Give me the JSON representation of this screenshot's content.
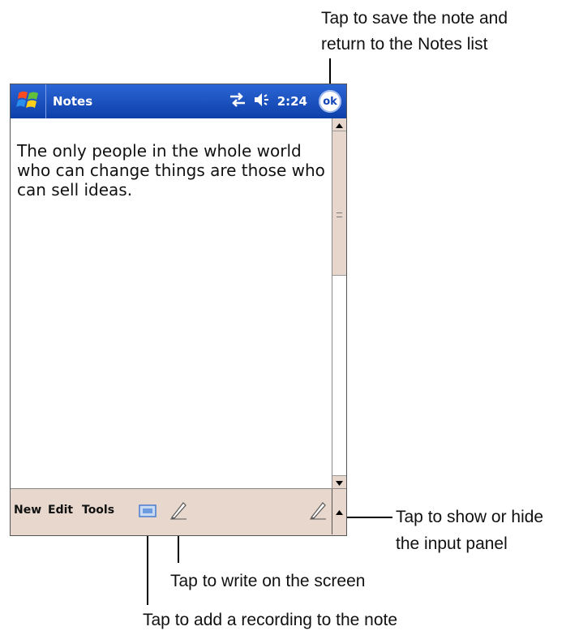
{
  "window": {
    "title": "Notes",
    "time": "2:24",
    "ok_label": "ok"
  },
  "note": {
    "text": "The only people in the whole world who can change things are those who can sell ideas."
  },
  "menubar": {
    "new_label": "New",
    "edit_label": "Edit",
    "tools_label": "Tools"
  },
  "callouts": {
    "ok_line1": "Tap to save the note and",
    "ok_line2": "return to the Notes list",
    "input_line1": "Tap to show or hide",
    "input_line2": "the input panel",
    "write": "Tap to write on the screen",
    "record": "Tap to add a recording to the note"
  },
  "colors": {
    "titlebar": "#1446b8",
    "menubar": "#e8d7cc"
  },
  "icons": [
    "windows-start-icon",
    "connectivity-icon",
    "speaker-icon",
    "ok-icon",
    "recording-icon",
    "pen-icon",
    "input-panel-icon",
    "scroll-up-icon",
    "scroll-down-icon",
    "sip-arrow-icon"
  ]
}
